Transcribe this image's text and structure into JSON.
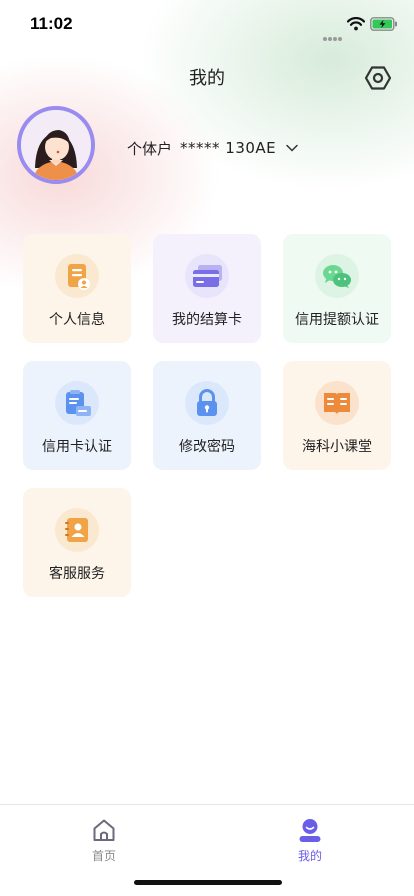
{
  "status_bar": {
    "time": "11:02",
    "icons": [
      "signal-dots-icon",
      "wifi-icon",
      "battery-charging-icon"
    ]
  },
  "header": {
    "title": "我的",
    "settings_icon": "settings-hexagon-icon"
  },
  "profile": {
    "account_type": "个体户",
    "account_number": "***** 130AE",
    "avatar_icon": "female-avatar-icon",
    "avatar_border_color": "#9a8bf0"
  },
  "menu": {
    "items": [
      {
        "label": "个人信息",
        "icon": "profile-document-icon",
        "tile_color": "#fdf5ea",
        "icon_color": "#f0a447"
      },
      {
        "label": "我的结算卡",
        "icon": "bank-card-icon",
        "tile_color": "#f4f1fd",
        "icon_color": "#7a6ee6"
      },
      {
        "label": "信用提额认证",
        "icon": "wechat-icon",
        "tile_color": "#effaf3",
        "icon_color": "#5ccf86"
      },
      {
        "label": "信用卡认证",
        "icon": "clipboard-card-icon",
        "tile_color": "#ecf3fd",
        "icon_color": "#5b92ef"
      },
      {
        "label": "修改密码",
        "icon": "lock-icon",
        "tile_color": "#ecf3fd",
        "icon_color": "#5b92ef"
      },
      {
        "label": "海科小课堂",
        "icon": "open-book-icon",
        "tile_color": "#fdf5ea",
        "icon_color": "#ee8a3c"
      },
      {
        "label": "客服服务",
        "icon": "contact-book-icon",
        "tile_color": "#fdf5ea",
        "icon_color": "#f0a447"
      }
    ]
  },
  "tabbar": {
    "home_label": "首页",
    "mine_label": "我的",
    "active_color": "#6a5de8",
    "inactive_color": "#8a8a8a"
  }
}
